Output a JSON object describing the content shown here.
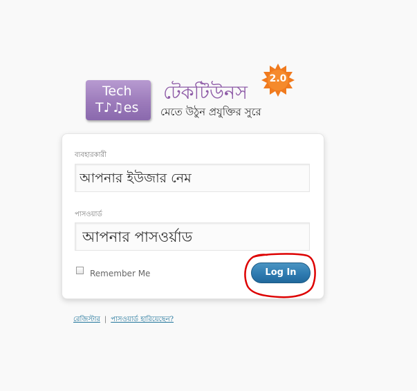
{
  "logo": {
    "tile_line1": "Tech",
    "tile_line2": "T♪♫es",
    "bangla_title": "টেকটিউনস",
    "tagline": "মেতে উঠুন প্রযুক্তির সুরে",
    "badge": "2.0",
    "tile_color": "#9c7bbb",
    "title_color": "#8d5aa6",
    "badge_color": "#f07a1e"
  },
  "form": {
    "username_label": "ব্যবহারকারী",
    "username_placeholder": "আপনার ইউজার নেম",
    "password_label": "পাসওয়ার্ড",
    "password_placeholder": "আপনার পাসওর্য়াড",
    "remember_label": "Remember Me",
    "remember_checked": false,
    "login_label": "Log In",
    "login_color": "#2e7bb1"
  },
  "links": {
    "register": "রেজিস্টার",
    "separator": "|",
    "lost_password": "পাসওয়ার্ড হারিয়েছেন?"
  },
  "annotation": {
    "highlight_color": "#dd0000"
  }
}
